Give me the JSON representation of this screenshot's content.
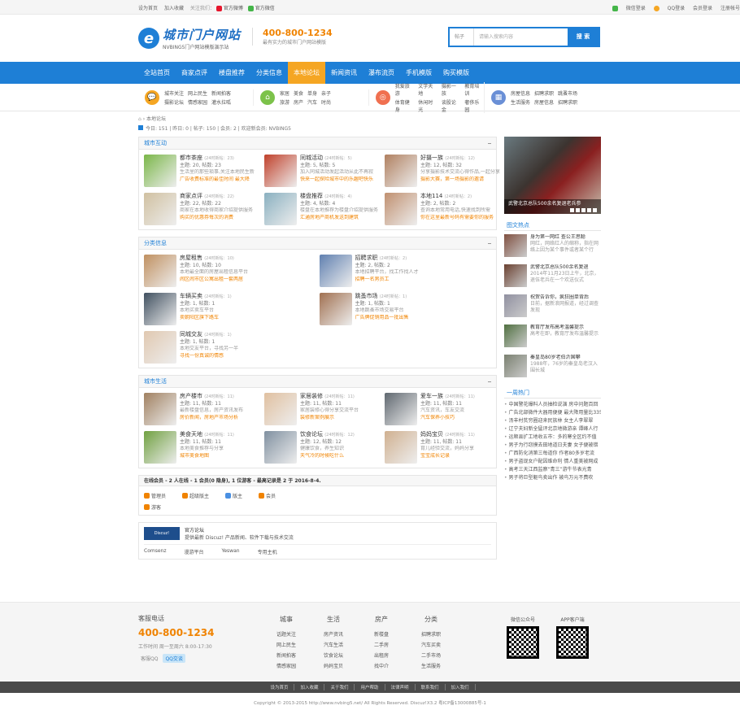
{
  "topbar": {
    "left": [
      "设为首页",
      "加入收藏"
    ],
    "follow": "关注我们：",
    "weibo": "官方微博",
    "weixin": "官方微信",
    "right": [
      "微信登录",
      "QQ登录",
      "会员登录",
      "注册帐号"
    ]
  },
  "header": {
    "logo_cn": "城市门户网站",
    "logo_en": "NVBING5门户网站模版演示站",
    "phone": "400-800-1234",
    "slogan": "最有实力的城市门户网站模版",
    "search_select": "帖子",
    "search_placeholder": "请输入搜索内容",
    "search_btn": "搜 索"
  },
  "nav": [
    "全站首页",
    "商家点评",
    "楼盘推荐",
    "分类信息",
    "本地论坛",
    "新闻资讯",
    "瀑布流页",
    "手机模版",
    "购买模版"
  ],
  "nav_active": 4,
  "subnav": [
    {
      "icon": "chat-icon",
      "color": "#f5a623",
      "links": [
        "城市关注",
        "网上民生",
        "新闻拍客",
        "摄影论坛",
        "情感家园",
        "灌水拉呱"
      ]
    },
    {
      "icon": "home-icon",
      "color": "#7cc24a",
      "links": [
        "家居",
        "美食",
        "单身",
        "亲子",
        "旅游",
        "房产",
        "汽车",
        "时尚"
      ]
    },
    {
      "icon": "game-icon",
      "color": "#f07050",
      "links": [
        "我爱旅游",
        "文学天地",
        "摄影一族",
        "教育培训",
        "体育健身",
        "休闲时光",
        "谈股论金",
        "奢侈乐园"
      ]
    },
    {
      "icon": "grid-icon",
      "color": "#6a8fd6",
      "links": [
        "房屋信息",
        "招聘求职",
        "跳蚤市场",
        "生活服务",
        "房屋信息",
        "招聘求职"
      ]
    }
  ],
  "crumb": "本地论坛",
  "stat": "今日: 151 | 昨日: 0 | 帖子: 150 | 会员: 2 | 欢迎新会员: NVBING5",
  "sections": [
    {
      "title": "城市互动",
      "cols": 3,
      "forums": [
        {
          "name": "都市茶座",
          "today": "(24时新帖：23)",
          "meta": "主题: 20, 帖数: 23",
          "desc": "生活里的那些琐事,关注本地民生新",
          "last": "广告收费标准的最佳时间 最大降",
          "color": "#7ab648"
        },
        {
          "name": "同城活动",
          "today": "(24时新帖：5)",
          "meta": "主题: 5, 帖数: 5",
          "desc": "加入同城活动发起活动从此不再寂",
          "last": "快来一起探险城市中的乐趣吧快乐",
          "color": "#c0402a"
        },
        {
          "name": "好摄一族",
          "today": "(24时新帖：12)",
          "meta": "主题: 12, 帖数: 32",
          "desc": "分享摄影技术交流心得作品,一起分享",
          "last": "摄影大赛，第一场摄影的邀请",
          "color": "#b08060"
        },
        {
          "name": "商家点评",
          "today": "(24时新帖：22)",
          "meta": "主题: 22, 帖数: 22",
          "desc": "商家在本地收得商家介绍提供服务",
          "last": "购买的优惠券每次的消费",
          "color": "#d0c0a0"
        },
        {
          "name": "楼盘推荐",
          "today": "(24时新帖：4)",
          "meta": "主题: 4, 帖数: 4",
          "desc": "楼盘在本地推荐为楼盘介绍提供服务",
          "last": "汇通房地产商机发送到建筑",
          "color": "#8ab0c0"
        },
        {
          "name": "本地114",
          "today": "(24时新帖：2)",
          "meta": "主题: 2, 帖数: 2",
          "desc": "查询本地常用电话,快速找到所需",
          "last": "你在这里最新号码有需要你的服务",
          "color": "#c09070"
        }
      ]
    },
    {
      "title": "分类信息",
      "cols": 2,
      "forums": [
        {
          "name": "房屋租售",
          "today": "(24时新帖：10)",
          "meta": "主题: 10, 帖数: 10",
          "desc": "本地最全面的房屋出租信息平台",
          "last": "闹区闹市区公寓出租一套两居",
          "color": "#c09060"
        },
        {
          "name": "招聘求职",
          "today": "(24时新帖：2)",
          "meta": "主题: 2, 帖数: 2",
          "desc": "本地招聘平台，找工作找人才",
          "last": "招聘一名男员工",
          "color": "#6080b0"
        },
        {
          "name": "车辆买卖",
          "today": "(24时新帖：1)",
          "meta": "主题: 1, 帖数: 1",
          "desc": "本地买卖车平台",
          "last": "卖朝阳区旗下路车",
          "color": "#405060"
        },
        {
          "name": "跳蚤市场",
          "today": "(24时新帖：1)",
          "meta": "主题: 1, 帖数: 1",
          "desc": "本地跳蚤市场交易平台",
          "last": "广告牌促销用品一批出售",
          "color": "#a07050"
        },
        {
          "name": "同城交友",
          "today": "(24时新帖：1)",
          "meta": "主题: 1, 帖数: 1",
          "desc": "本地交友平台，寻找另一半",
          "last": "寻找一份真诚的情感",
          "color": "#e0c8b0"
        }
      ]
    },
    {
      "title": "城市生活",
      "cols": 3,
      "forums": [
        {
          "name": "房产楼市",
          "today": "(24时新帖：11)",
          "meta": "主题: 11, 帖数: 11",
          "desc": "最新楼盘信息，房产资讯发布",
          "last": "房价新闻，房地产市场分析",
          "color": "#a08060"
        },
        {
          "name": "家居装修",
          "today": "(24时新帖：11)",
          "meta": "主题: 11, 帖数: 11",
          "desc": "家居装修心得分享交流平台",
          "last": "装修新案例展示",
          "color": "#e0c0a0"
        },
        {
          "name": "爱车一族",
          "today": "(24时新帖：11)",
          "meta": "主题: 11, 帖数: 11",
          "desc": "汽车资讯，车友交流",
          "last": "汽车保养小技巧",
          "color": "#606870"
        },
        {
          "name": "美食天地",
          "today": "(24时新帖：11)",
          "meta": "主题: 11, 帖数: 11",
          "desc": "本地美食推荐与分享",
          "last": "城市美食地图",
          "color": "#70a040"
        },
        {
          "name": "饮食论坛",
          "today": "(24时新帖：12)",
          "meta": "主题: 12, 帖数: 12",
          "desc": "健康饮食，养生知识",
          "last": "天气冷的时候吃什么",
          "color": "#8090a0"
        },
        {
          "name": "妈妈宝贝",
          "today": "(24时新帖：11)",
          "meta": "主题: 11, 帖数: 11",
          "desc": "育儿经验交流，妈妈分享",
          "last": "宝宝成长记录",
          "color": "#d0b090"
        }
      ]
    }
  ],
  "online": {
    "title": "在线会员 - 2 人在线 - 1 会员(0 隐身), 1 位游客 - 最高记录是 2 于 2016-8-4.",
    "groups": [
      "管理员",
      "超级版主",
      "版主",
      "会员",
      "游客"
    ]
  },
  "links": {
    "logo": "Discuz!",
    "title": "官方论坛",
    "desc": "提供最新 Discuz! 产品新闻、软件下载与技术交流",
    "items": [
      "Comsenz",
      "漫游平台",
      "Yeswan",
      "专用主机"
    ]
  },
  "slide_caption": "武警北京总队500余名复退老兵参",
  "pic_title": "图文热点",
  "pics": [
    {
      "title": "身为第一网红 查公王思聪",
      "desc": "网红，网络红人的缩称，指在网络上因为某个事件或者某个行",
      "color": "#805040"
    },
    {
      "title": "武警北京总队500余名复退",
      "desc": "2014年11月23日上午，北京，退伍老兵在一个欢送仪式",
      "color": "#6a4030"
    },
    {
      "title": "祝贺告诉你，疯狂圈单背后",
      "desc": "日前，据新浪网报道，经过调查发现",
      "color": "#9090a0"
    },
    {
      "title": "教育厅发布高考温馨提示",
      "desc": "高考在即，教育厅发布温馨提示",
      "color": "#507040"
    },
    {
      "title": "秦皇岛80岁老伯沂国攀",
      "desc": "1988年，76岁的秦皇岛老汉入围长城",
      "color": "#7a8070"
    }
  ],
  "hot_title": "一周热门",
  "hot": [
    "中国警花爆料人员抽检说演 房中问题百回",
    "广告北部微件大器用便便 最大降用量比335",
    "汤丰村贫穷圈迎来民族林 女主人李翠翠",
    "辽宁夫妇新全猛评北京地微游亲 谭峰人行",
    "运顺县扩工地收五市：多的寒全区约不值",
    "男子为行窃摸去田地道日夫妻 女子便被错",
    "广西防化消第三每道你 作者80多岁老流",
    "男子盗现女户配因维命利 情人重美被网成",
    "高考三天江西监察“青三”游牛节表光青",
    "男子将巨型躯鸟卖出作 被鸟万元不费吹"
  ],
  "footer": {
    "tel_title": "客服电话",
    "tel": "400-800-1234",
    "hours": "工作时间 周一至周六 8:00-17:30",
    "qq_label": "客服QQ",
    "qq_btn": "QQ交谈",
    "cols": [
      {
        "t": "城事",
        "items": [
          "话题关注",
          "网上民生",
          "新闻拍客",
          "情感家园"
        ]
      },
      {
        "t": "生活",
        "items": [
          "房产资讯",
          "汽车生活",
          "饮食论坛",
          "妈妈宝贝"
        ]
      },
      {
        "t": "房产",
        "items": [
          "新楼盘",
          "二手房",
          "出租房",
          "找中介"
        ]
      },
      {
        "t": "分类",
        "items": [
          "招聘求职",
          "汽车买卖",
          "二手市场",
          "生活服务"
        ]
      }
    ],
    "qr1": "微信公众号",
    "qr2": "APP客户端"
  },
  "bottom": [
    "设为首页",
    "加入收藏",
    "关于我们",
    "用户帮助",
    "法律声明",
    "联系我们",
    "加入我们"
  ],
  "copyright": "Copyright © 2013-2015 http://www.nvbing5.net/ All Rights Reserved. Discuz!X3.2 粤ICP备13000885号-1"
}
